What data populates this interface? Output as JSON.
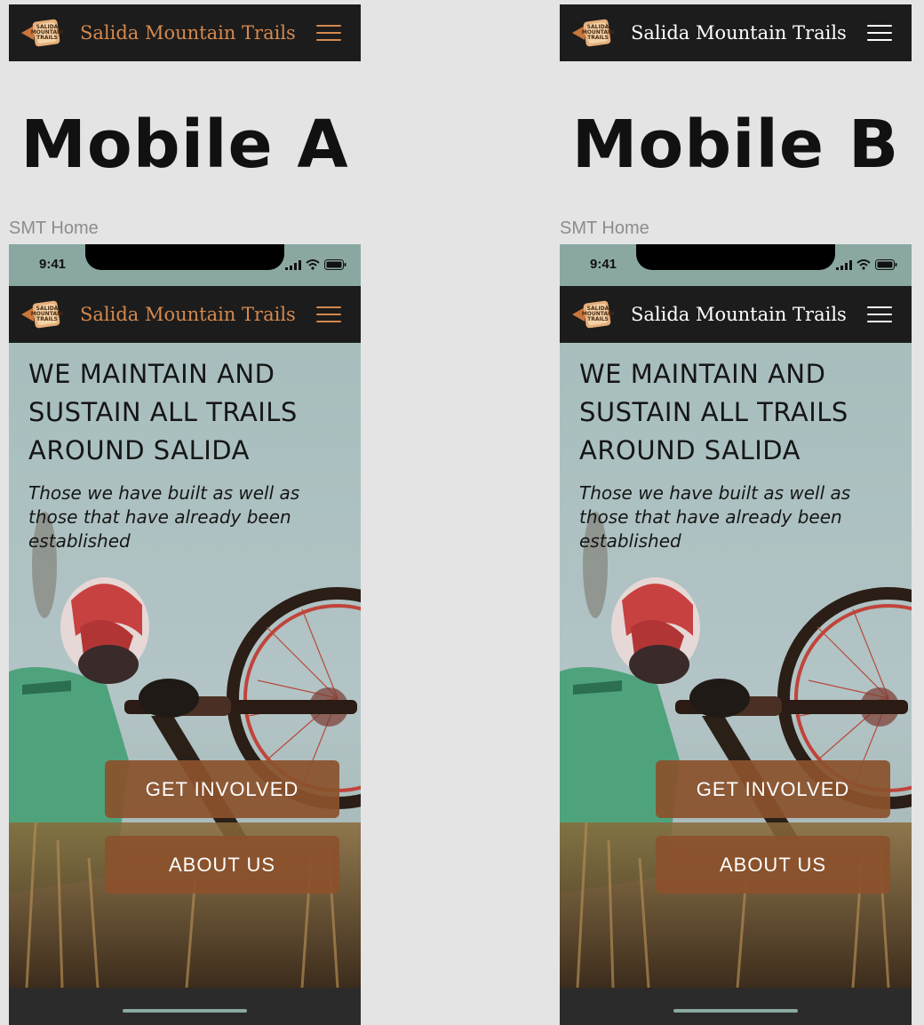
{
  "variants": [
    {
      "id": "A",
      "title": "Mobile A",
      "frame_label": "SMT Home",
      "nav": {
        "brand": "Salida Mountain Trails",
        "brand_color": "#d5894e",
        "menu_color": "#d5894e"
      },
      "status": {
        "time": "9:41"
      },
      "hero": {
        "title": "WE MAINTAIN AND SUSTAIN ALL TRAILS AROUND SALIDA",
        "subtitle": "Those we have built as well as those that have already been established"
      },
      "buttons": {
        "get_involved": "GET INVOLVED",
        "about_us": "ABOUT US"
      }
    },
    {
      "id": "B",
      "title": "Mobile B",
      "frame_label": "SMT Home",
      "nav": {
        "brand": "Salida Mountain Trails",
        "brand_color": "#ffffff",
        "menu_color": "#ffffff"
      },
      "status": {
        "time": "9:41"
      },
      "hero": {
        "title": "WE MAINTAIN AND SUSTAIN ALL TRAILS AROUND SALIDA",
        "subtitle": "Those we have built as well as those that have already been established"
      },
      "buttons": {
        "get_involved": "GET INVOLVED",
        "about_us": "ABOUT US"
      }
    }
  ],
  "logo": {
    "text_lines": [
      "SALIDA",
      "MOUNTAIN",
      "TRAILS"
    ],
    "icon": "salida-mountain-trails-logo"
  },
  "colors": {
    "navbar": "#1c1c1c",
    "accent": "#d5894e",
    "button": "#8b522c",
    "page_bg": "#e4e4e4"
  }
}
